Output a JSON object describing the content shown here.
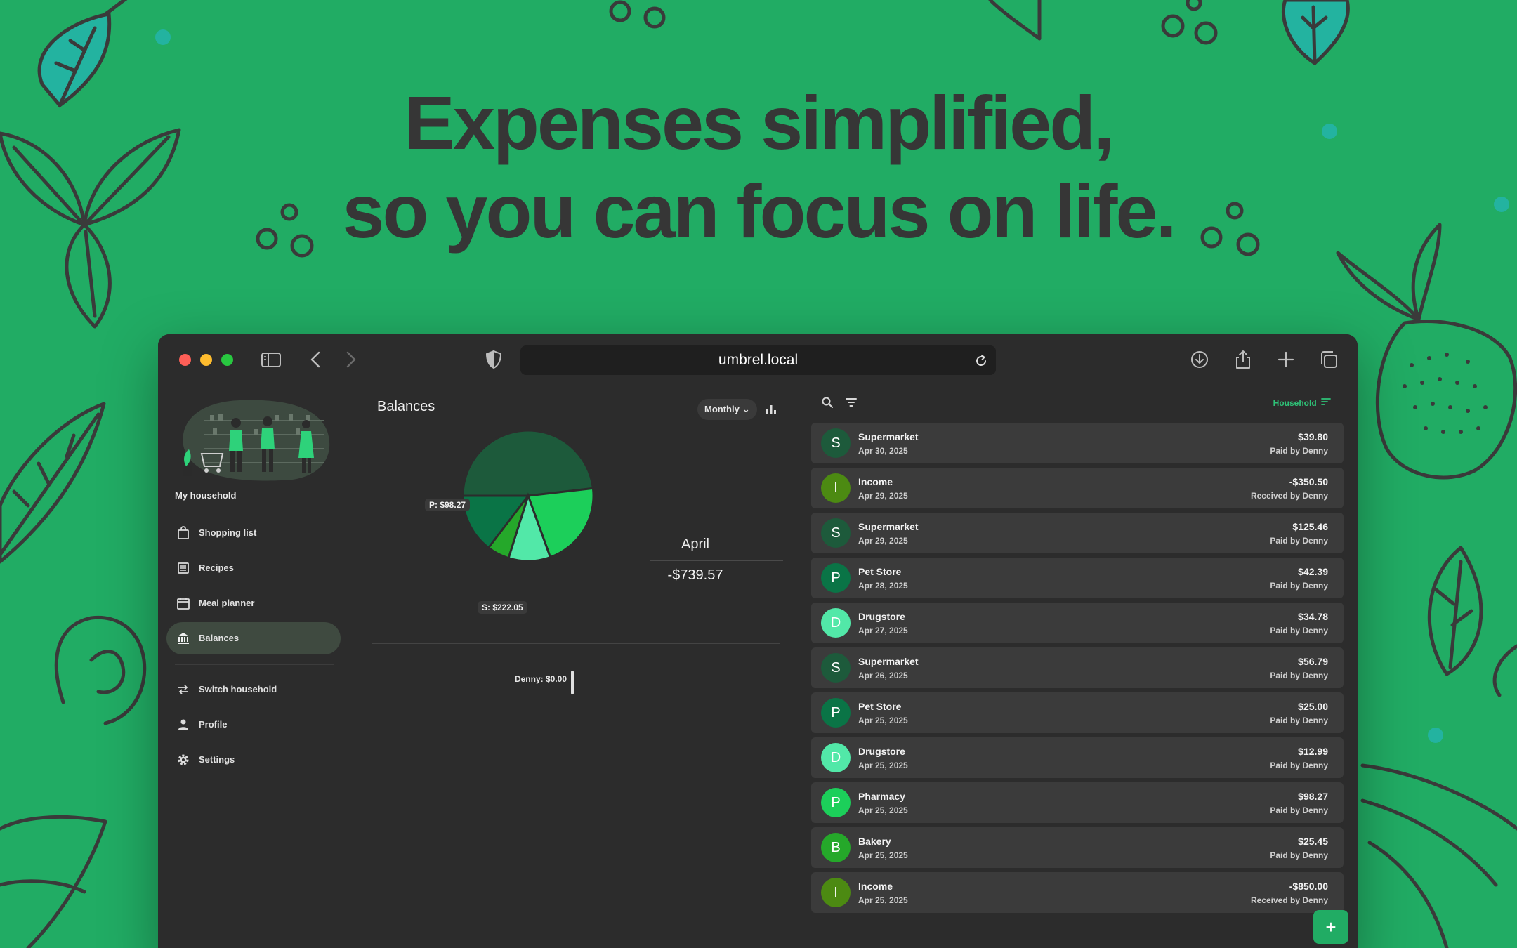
{
  "headline": {
    "line1": "Expenses simplified,",
    "line2": "so you can focus on life."
  },
  "colors": {
    "background": "#21ac64",
    "window": "#2c2c2c",
    "accent": "#2ec277",
    "row": "#3b3b3b"
  },
  "browser": {
    "url": "umbrel.local",
    "icons": [
      "sidebar-icon",
      "back-icon",
      "forward-icon",
      "shield-icon",
      "reload-icon",
      "download-icon",
      "share-icon",
      "new-tab-icon",
      "tabs-icon"
    ]
  },
  "sidebar": {
    "household_title": "My household",
    "items": [
      {
        "label": "Shopping list",
        "icon": "shopping-bag-icon"
      },
      {
        "label": "Recipes",
        "icon": "recipes-icon"
      },
      {
        "label": "Meal planner",
        "icon": "calendar-icon"
      },
      {
        "label": "Balances",
        "icon": "bank-icon",
        "active": true
      }
    ],
    "secondary": [
      {
        "label": "Switch household",
        "icon": "switch-icon"
      },
      {
        "label": "Profile",
        "icon": "person-icon"
      },
      {
        "label": "Settings",
        "icon": "gear-icon"
      }
    ]
  },
  "balances": {
    "title": "Balances",
    "period": "Monthly",
    "month": "April",
    "total": "-$739.57",
    "member_balance": "Denny: $0.00"
  },
  "chart_data": {
    "type": "pie",
    "slices": [
      {
        "label": "S",
        "value": 222.05,
        "color": "#1d5a3b"
      },
      {
        "label": "P",
        "value": 98.27,
        "color": "#1ccf5a"
      },
      {
        "label": "D",
        "value": 47.77,
        "color": "#52e8a8"
      },
      {
        "label": "B",
        "value": 25.45,
        "color": "#25a82a"
      },
      {
        "label": "P",
        "value": 67.39,
        "color": "#0a7446"
      }
    ],
    "data_labels": [
      "P: $98.27",
      "S: $222.05"
    ]
  },
  "expenses": {
    "filter_label": "Household",
    "items": [
      {
        "initial": "S",
        "name": "Supermarket",
        "date": "Apr 30, 2025",
        "amount": "$39.80",
        "payer": "Paid by Denny",
        "color": "#1d5a3b"
      },
      {
        "initial": "I",
        "name": "Income",
        "date": "Apr 29, 2025",
        "amount": "-$350.50",
        "payer": "Received by Denny",
        "color": "#4c8a12"
      },
      {
        "initial": "S",
        "name": "Supermarket",
        "date": "Apr 29, 2025",
        "amount": "$125.46",
        "payer": "Paid by Denny",
        "color": "#1d5a3b"
      },
      {
        "initial": "P",
        "name": "Pet Store",
        "date": "Apr 28, 2025",
        "amount": "$42.39",
        "payer": "Paid by Denny",
        "color": "#0a7446"
      },
      {
        "initial": "D",
        "name": "Drugstore",
        "date": "Apr 27, 2025",
        "amount": "$34.78",
        "payer": "Paid by Denny",
        "color": "#52e8a8"
      },
      {
        "initial": "S",
        "name": "Supermarket",
        "date": "Apr 26, 2025",
        "amount": "$56.79",
        "payer": "Paid by Denny",
        "color": "#1d5a3b"
      },
      {
        "initial": "P",
        "name": "Pet Store",
        "date": "Apr 25, 2025",
        "amount": "$25.00",
        "payer": "Paid by Denny",
        "color": "#0a7446"
      },
      {
        "initial": "D",
        "name": "Drugstore",
        "date": "Apr 25, 2025",
        "amount": "$12.99",
        "payer": "Paid by Denny",
        "color": "#52e8a8"
      },
      {
        "initial": "P",
        "name": "Pharmacy",
        "date": "Apr 25, 2025",
        "amount": "$98.27",
        "payer": "Paid by Denny",
        "color": "#1ccf5a"
      },
      {
        "initial": "B",
        "name": "Bakery",
        "date": "Apr 25, 2025",
        "amount": "$25.45",
        "payer": "Paid by Denny",
        "color": "#25a82a"
      },
      {
        "initial": "I",
        "name": "Income",
        "date": "Apr 25, 2025",
        "amount": "-$850.00",
        "payer": "Received by Denny",
        "color": "#4c8a12"
      }
    ]
  },
  "fab_label": "+"
}
